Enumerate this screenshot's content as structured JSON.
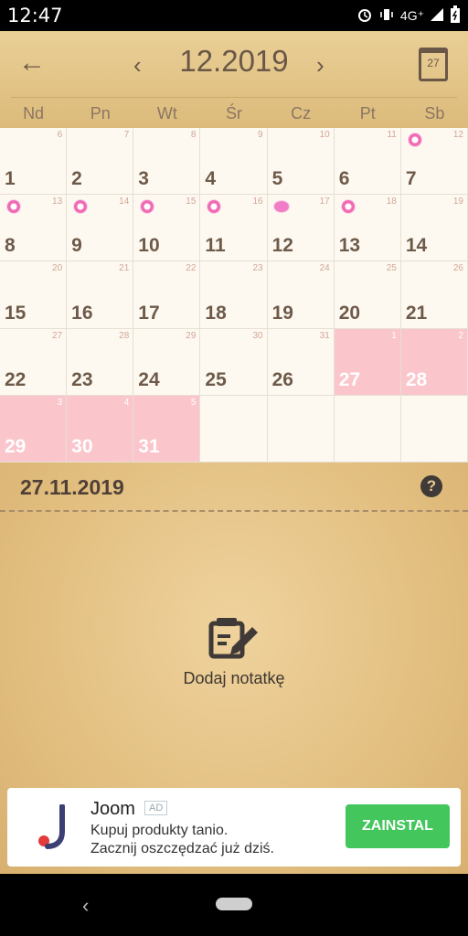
{
  "status_bar": {
    "time": "12:47",
    "network": "4G⁺"
  },
  "header": {
    "month": "12.2019",
    "calendar_day": "27",
    "weekdays": [
      "Nd",
      "Pn",
      "Wt",
      "Śr",
      "Cz",
      "Pt",
      "Sb"
    ]
  },
  "calendar": {
    "cells": [
      {
        "day": "1",
        "sub": "6"
      },
      {
        "day": "2",
        "sub": "7"
      },
      {
        "day": "3",
        "sub": "8"
      },
      {
        "day": "4",
        "sub": "9"
      },
      {
        "day": "5",
        "sub": "10"
      },
      {
        "day": "6",
        "sub": "11"
      },
      {
        "day": "7",
        "sub": "12"
      },
      {
        "day": "8",
        "sub": "13"
      },
      {
        "day": "9",
        "sub": "14"
      },
      {
        "day": "10",
        "sub": "15"
      },
      {
        "day": "11",
        "sub": "16"
      },
      {
        "day": "12",
        "sub": "17"
      },
      {
        "day": "13",
        "sub": "18"
      },
      {
        "day": "14",
        "sub": "19"
      },
      {
        "day": "15",
        "sub": "20"
      },
      {
        "day": "16",
        "sub": "21"
      },
      {
        "day": "17",
        "sub": "22"
      },
      {
        "day": "18",
        "sub": "23"
      },
      {
        "day": "19",
        "sub": "24"
      },
      {
        "day": "20",
        "sub": "25"
      },
      {
        "day": "21",
        "sub": "26"
      },
      {
        "day": "22",
        "sub": "27"
      },
      {
        "day": "23",
        "sub": "28"
      },
      {
        "day": "24",
        "sub": "29"
      },
      {
        "day": "25",
        "sub": "30"
      },
      {
        "day": "26",
        "sub": "31"
      },
      {
        "day": "27",
        "sub": "1"
      },
      {
        "day": "28",
        "sub": "2"
      },
      {
        "day": "29",
        "sub": "3"
      },
      {
        "day": "30",
        "sub": "4"
      },
      {
        "day": "31",
        "sub": "5"
      },
      {
        "day": "",
        "sub": ""
      },
      {
        "day": "",
        "sub": ""
      },
      {
        "day": "",
        "sub": ""
      },
      {
        "day": "",
        "sub": ""
      }
    ]
  },
  "note": {
    "date": "27.11.2019",
    "help_label": "?",
    "add_label": "Dodaj notatkę"
  },
  "ad": {
    "name": "Joom",
    "tag": "AD",
    "line1": "Kupuj produkty tanio.",
    "line2": "Zacznij oszczędzać już dziś.",
    "install_label": "ZAINSTAL"
  },
  "colors": {
    "period": "#fbc5cc",
    "marker": "#f06bb4",
    "install": "#43c65c"
  }
}
